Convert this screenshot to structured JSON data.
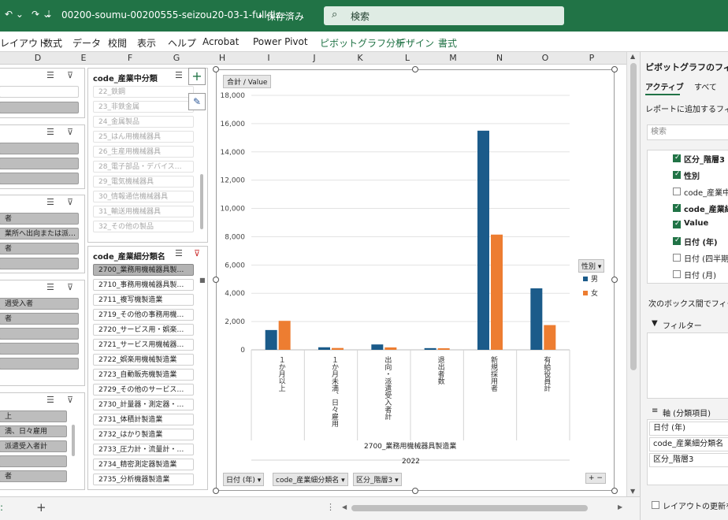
{
  "titlebar": {
    "filename": "00200-soumu-00200555-seizou20-03-1-full-lis···",
    "saved": "• 保存済み",
    "search_placeholder": "検索"
  },
  "ribbon_tabs": [
    "レイアウト",
    "数式",
    "データ",
    "校閲",
    "表示",
    "ヘルプ",
    "Acrobat",
    "Power Pivot",
    "ピボットグラフ分析",
    "デザイン",
    "書式"
  ],
  "columns": [
    "D",
    "E",
    "F",
    "G",
    "H",
    "I",
    "J",
    "K",
    "L",
    "M",
    "N",
    "O",
    "P"
  ],
  "left_slicers": {
    "s2_items": [
      "者",
      "業所へ出向または派…",
      "者",
      ""
    ],
    "s4_items": [
      "週受入者",
      "者",
      "",
      ""
    ],
    "s5_items": [
      "上",
      "満、日々雇用",
      "派遣受入者計",
      "",
      "者"
    ]
  },
  "slicer_mid": {
    "title": "code_産業中分類",
    "items": [
      "22_鉄鋼",
      "23_非鉄金属",
      "24_金属製品",
      "25_はん用機械器具",
      "26_生産用機械器具",
      "28_電子部品・デバイス…",
      "29_電気機械器具",
      "30_情報通信機械器具",
      "31_輸送用機械器具",
      "32_その他の製品"
    ]
  },
  "slicer_detail": {
    "title": "code_産業細分類名",
    "items": [
      "2700_業務用機械器具製…",
      "2710_事務用機械器具製…",
      "2711_複写機製造業",
      "2719_その他の事務用機…",
      "2720_サービス用・娯楽…",
      "2721_サービス用機械器…",
      "2722_娯楽用機械製造業",
      "2723_自動販売機製造業",
      "2729_その他のサービス…",
      "2730_計量器・測定器・…",
      "2731_体積計製造業",
      "2732_はかり製造業",
      "2733_圧力計・流量計・…",
      "2734_精密測定器製造業",
      "2735_分析機器製造業"
    ]
  },
  "chart": {
    "value_button": "合計 / Value",
    "legend_button": "性別 ▾",
    "axis_group1": "2700_業務用機械器具製造業",
    "axis_group2": "2022",
    "filter_buttons": [
      "日付 (年) ▾",
      "code_産業細分類名 ▾",
      "区分_階層3 ▾"
    ],
    "zoom": "+ −"
  },
  "chart_data": {
    "type": "bar",
    "categories": [
      "１か月以上",
      "１か月未満、日々雇用",
      "出向・派遣受入者計",
      "退出者数",
      "新規採用者",
      "有給役員計"
    ],
    "series": [
      {
        "name": "男",
        "values": [
          1400,
          180,
          380,
          120,
          15500,
          4350
        ]
      },
      {
        "name": "女",
        "values": [
          2050,
          130,
          170,
          110,
          8150,
          1750
        ]
      }
    ],
    "yticks": [
      "0",
      "2,000",
      "4,000",
      "6,000",
      "8,000",
      "10,000",
      "12,000",
      "14,000",
      "16,000",
      "18,000"
    ],
    "ylim": [
      0,
      18000
    ],
    "colors": [
      "#1b5b8a",
      "#ed7d31"
    ],
    "grid": true,
    "legend": "right"
  },
  "fieldpane": {
    "title": "ピボットグラフのフィー…",
    "tab_active": "アクティブ",
    "tab_all": "すべて",
    "add_label": "レポートに追加するフィール…",
    "search_placeholder": "検索",
    "fields": [
      {
        "label": "区分_階層3",
        "checked": true,
        "bold": true
      },
      {
        "label": "性別",
        "checked": true,
        "bold": true
      },
      {
        "label": "code_産業中…",
        "checked": false,
        "bold": false
      },
      {
        "label": "code_産業細…",
        "checked": true,
        "bold": true
      },
      {
        "label": "Value",
        "checked": true,
        "bold": true
      },
      {
        "label": "日付 (年)",
        "checked": true,
        "bold": true
      },
      {
        "label": "日付 (四半期…",
        "checked": false,
        "bold": false
      },
      {
        "label": "日付 (月)",
        "checked": false,
        "bold": false
      }
    ],
    "drag_label": "次のボックス間でフィールド…",
    "filter_label": "フィルター",
    "axis_label": "軸 (分類項目)",
    "axis_items": [
      "日付 (年)",
      "code_産業細分類名",
      "区分_階層3"
    ],
    "defer_label": "レイアウトの更新を保…"
  }
}
